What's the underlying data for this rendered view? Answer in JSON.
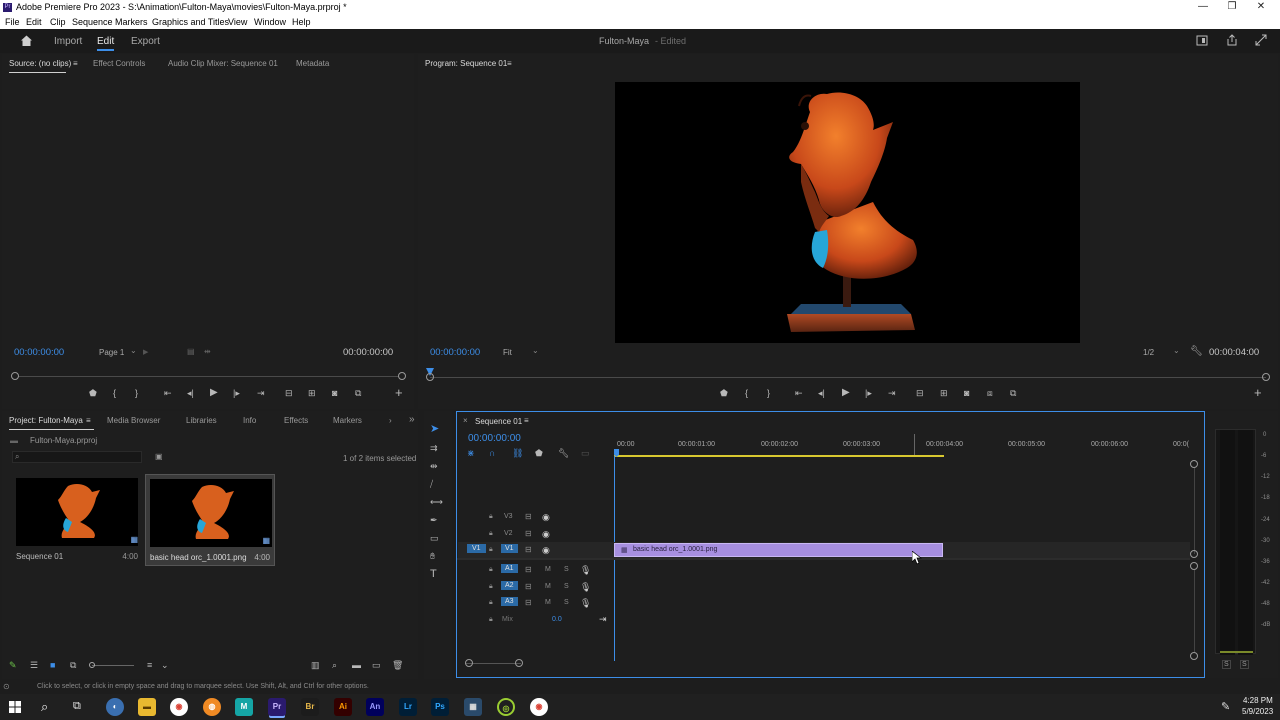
{
  "window": {
    "title": "Adobe Premiere Pro 2023 - S:\\Animation\\Fulton-Maya\\movies\\Fulton-Maya.prproj *",
    "app_icon": "Pr",
    "controls": {
      "minimize": "—",
      "restore": "❐",
      "close": "✕"
    }
  },
  "menubar": [
    "File",
    "Edit",
    "Clip",
    "Sequence",
    "Markers",
    "Graphics and Titles",
    "View",
    "Window",
    "Help"
  ],
  "header": {
    "home_icon": "home-icon",
    "tabs": [
      "Import",
      "Edit",
      "Export"
    ],
    "active_tab": "Edit",
    "project_name": "Fulton-Maya",
    "project_status": "- Edited"
  },
  "source_panel": {
    "tabs": [
      "Source: (no clips)",
      "Effect Controls",
      "Audio Clip Mixer: Sequence 01",
      "Metadata"
    ],
    "menu_icon": "≡",
    "timecode_in": "00:00:00:00",
    "page_select": "Page 1",
    "timecode_out": "00:00:00:00"
  },
  "program_panel": {
    "title": "Program: Sequence 01",
    "menu_icon": "≡",
    "timecode": "00:00:00:00",
    "fit_select": "Fit",
    "resolution": "1/2",
    "duration": "00:00:04:00",
    "add_icon": "+"
  },
  "project_panel": {
    "tabs": [
      "Project: Fulton-Maya",
      "Media Browser",
      "Libraries",
      "Info",
      "Effects",
      "Markers"
    ],
    "project_file": "Fulton-Maya.prproj",
    "selection_count": "1 of 2 items selected",
    "search_placeholder": "",
    "items": [
      {
        "name": "Sequence 01",
        "duration": "4:00"
      },
      {
        "name": "basic head orc_1.0001.png",
        "duration": "4:00"
      }
    ]
  },
  "sequence_panel": {
    "tab": "Sequence 01",
    "timecode": "00:00:00:00",
    "ruler": [
      "00:00",
      "00:00:01:00",
      "00:00:02:00",
      "00:00:03:00",
      "00:00:04:00",
      "00:00:05:00",
      "00:00:06:00",
      "00:0("
    ],
    "video_tracks": [
      "V3",
      "V2",
      "V1"
    ],
    "audio_tracks": [
      "A1",
      "A2",
      "A3"
    ],
    "source_patch": "V1",
    "mix_label": "Mix",
    "mix_value": "0.0",
    "clip_name": "basic head orc_1.0001.png",
    "mute": "M",
    "solo": "S"
  },
  "meter": {
    "labels": [
      "0",
      "-6",
      "-12",
      "-18",
      "-24",
      "-30",
      "-36",
      "-42",
      "-48",
      "-dB"
    ],
    "solo": [
      "S",
      "S"
    ]
  },
  "statusbar": {
    "hint": "Click to select, or click in empty space and drag to marquee select. Use Shift, Alt, and Ctrl for other options."
  },
  "taskbar": {
    "apps": [
      "Br",
      "Ai",
      "An",
      "Lr",
      "Ps"
    ],
    "time": "4:28 PM",
    "date": "5/9/2023"
  },
  "colors": {
    "accent": "#3d8ee8",
    "clip": "#a78fe0",
    "bg": "#1e1e1e"
  }
}
